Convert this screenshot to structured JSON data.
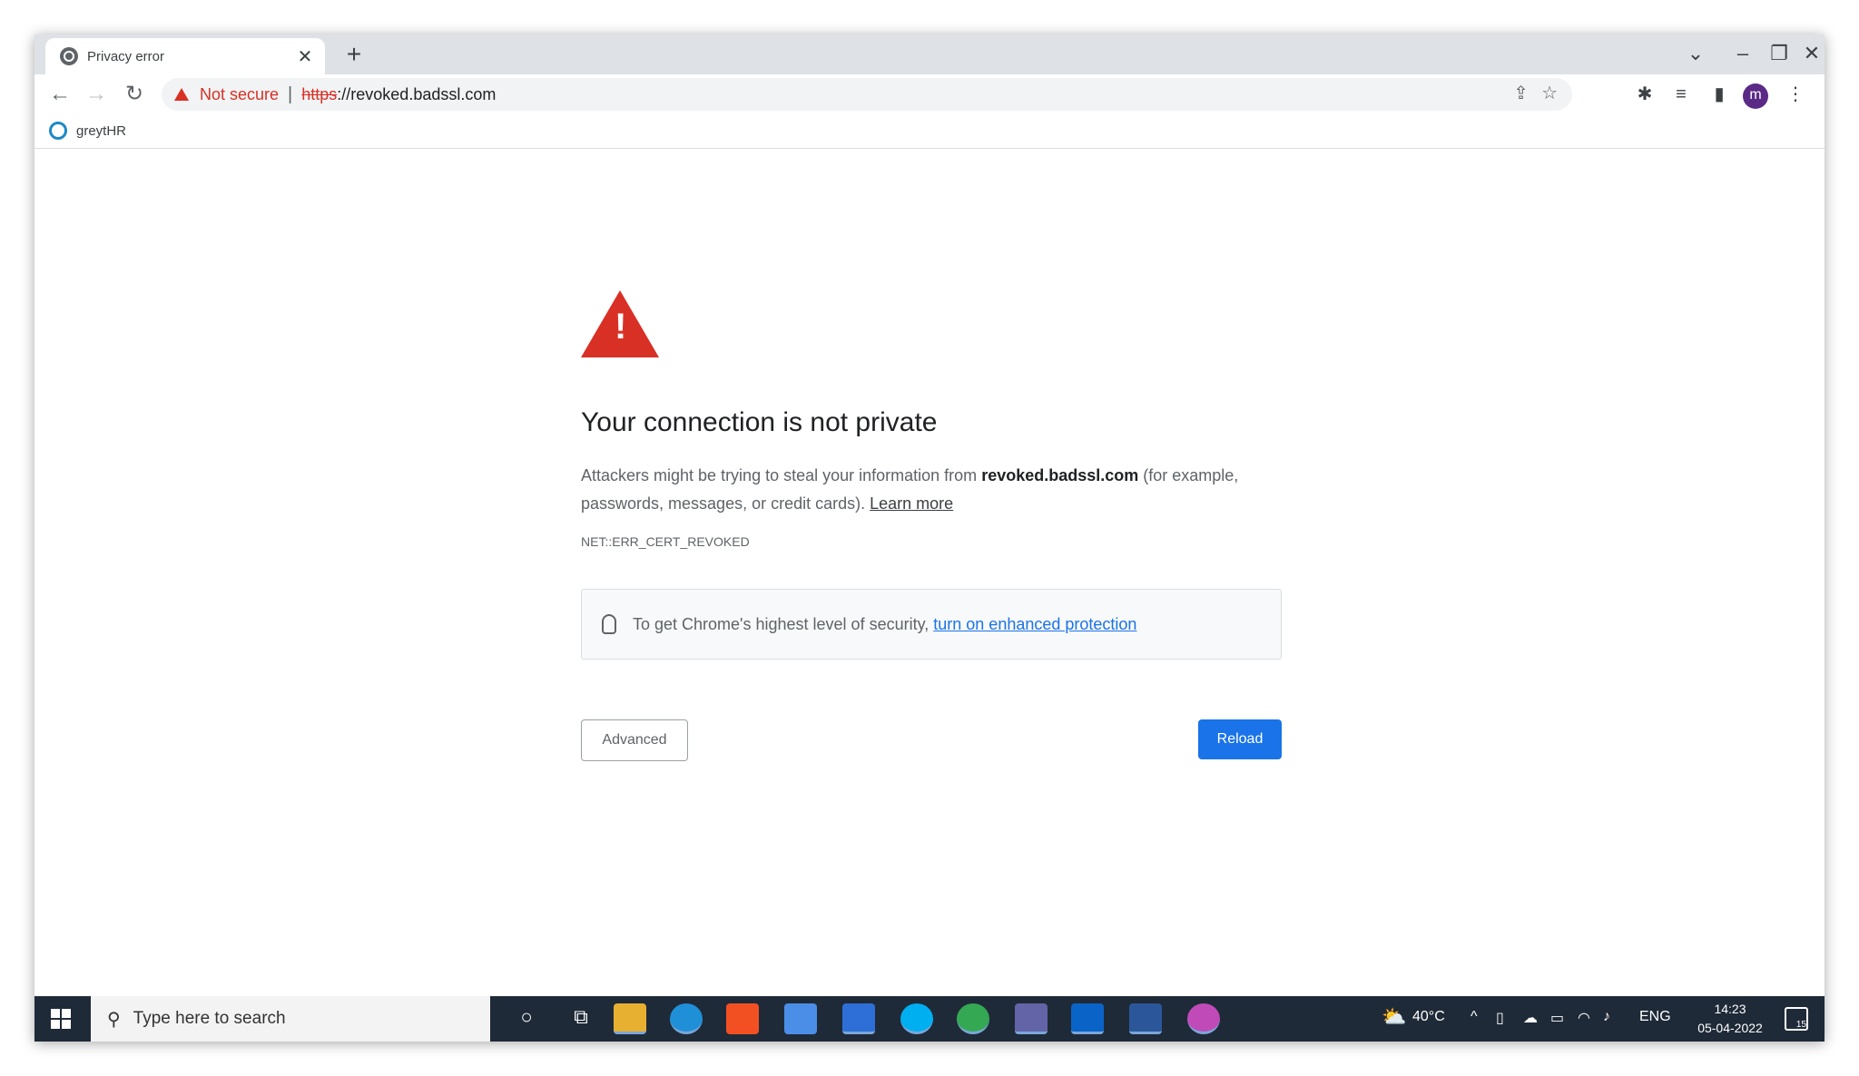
{
  "browser": {
    "tab_title": "Privacy error",
    "new_tab_label": "+",
    "security_label": "Not secure",
    "url_scheme": "https",
    "url_rest": "://revoked.badssl.com",
    "profile_initial": "m",
    "bookmark_label": "greytHR"
  },
  "page": {
    "heading": "Your connection is not private",
    "message_prefix": "Attackers might be trying to steal your information from ",
    "message_host": "revoked.badssl.com",
    "message_suffix": " (for example, passwords, messages, or credit cards). ",
    "learn_more": "Learn more",
    "error_code": "NET::ERR_CERT_REVOKED",
    "enhanced_prefix": "To get Chrome's highest level of security, ",
    "enhanced_link": "turn on enhanced protection",
    "advanced_button": "Advanced",
    "reload_button": "Reload"
  },
  "taskbar": {
    "search_placeholder": "Type here to search",
    "temperature": "40°C",
    "language": "ENG",
    "time": "14:23",
    "date": "05-04-2022",
    "notification_count": "15"
  },
  "colors": {
    "danger": "#d93025",
    "accent": "#1a73e8",
    "taskbar": "#1f2a38"
  }
}
